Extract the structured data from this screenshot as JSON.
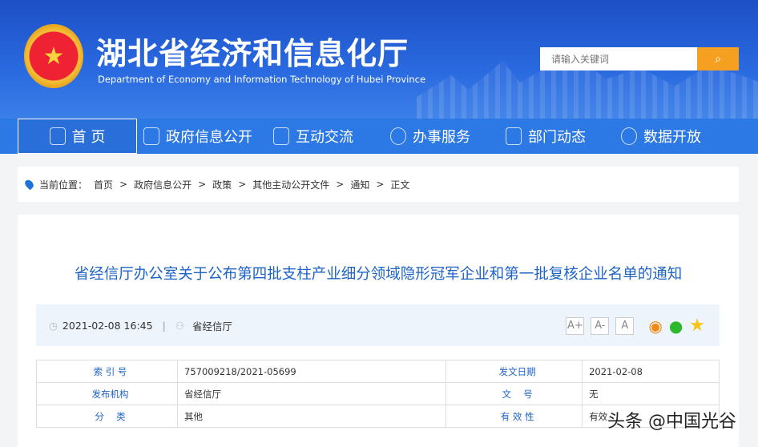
{
  "header": {
    "title": "湖北省经济和信息化厅",
    "subtitle": "Department of Economy and Information Technology of Hubei Province",
    "emblem": "★",
    "search_placeholder": "请输入关键词",
    "search_icon": "⌕"
  },
  "nav": [
    {
      "label": "首 页"
    },
    {
      "label": "政府信息公开"
    },
    {
      "label": "互动交流"
    },
    {
      "label": "办事服务"
    },
    {
      "label": "部门动态"
    },
    {
      "label": "数据开放"
    }
  ],
  "breadcrumb": {
    "label": "当前位置：",
    "items": [
      "首页",
      "政府信息公开",
      "政策",
      "其他主动公开文件",
      "通知",
      "正文"
    ],
    "sep": ">"
  },
  "article": {
    "title": "省经信厅办公室关于公布第四批支柱产业细分领域隐形冠军企业和第一批复核企业名单的通知",
    "datetime": "2021-02-08 16:45",
    "divider": "|",
    "source": "省经信厅",
    "font_buttons": [
      "A+",
      "A-",
      "A"
    ]
  },
  "info_table": [
    [
      "索 引 号",
      "757009218/2021-05699",
      "发文日期",
      "2021-02-08"
    ],
    [
      "发布机构",
      "省经信厅",
      "文　 号",
      "无"
    ],
    [
      "分　 类",
      "其他",
      "有 效 性",
      "有效"
    ]
  ],
  "watermark": "头条 @中国光谷"
}
